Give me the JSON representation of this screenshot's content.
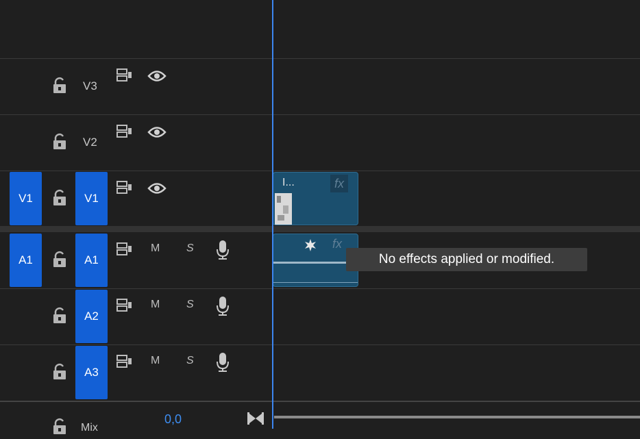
{
  "tracks": {
    "video": [
      {
        "name": "V3"
      },
      {
        "name": "V2"
      },
      {
        "name": "V1",
        "source": "V1"
      }
    ],
    "audio": [
      {
        "name": "A1",
        "source": "A1",
        "mute": "M",
        "solo": "S"
      },
      {
        "name": "A2",
        "mute": "M",
        "solo": "S"
      },
      {
        "name": "A3",
        "mute": "M",
        "solo": "S"
      }
    ],
    "mix": {
      "label": "Mix",
      "value": "0,0"
    }
  },
  "clips": {
    "video_clip_label": "I...",
    "fx_label": "fx"
  },
  "tooltip": "No effects applied or modified.",
  "colors": {
    "accent": "#1360d6",
    "playhead": "#3c86f0",
    "clip": "#1b4f6e"
  }
}
